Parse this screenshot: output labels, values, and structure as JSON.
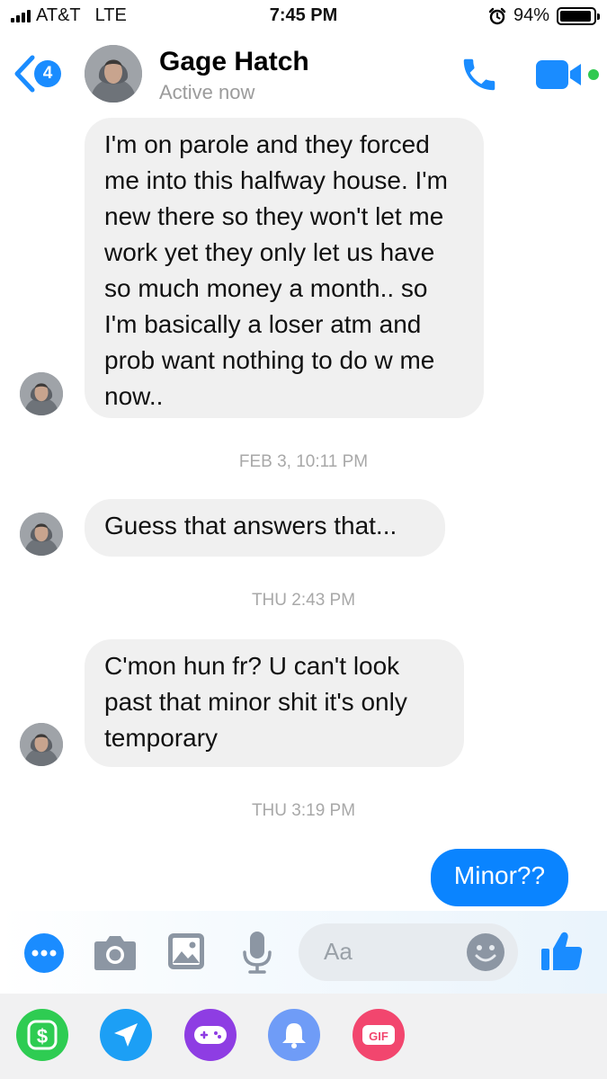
{
  "status_bar": {
    "carrier": "AT&T",
    "network": "LTE",
    "time": "7:45 PM",
    "battery_percent": "94%",
    "battery_level": 0.94
  },
  "header": {
    "back_badge_count": "4",
    "contact_name": "Gage Hatch",
    "contact_status": "Active now",
    "icons": [
      "back-chevron-icon",
      "phone-icon",
      "video-camera-icon",
      "online-dot-icon"
    ]
  },
  "messages": [
    {
      "from": "contact",
      "text": "I'm on parole and they forced me into this halfway house. I'm new there so they won't let me work yet they only let us have so much money a month.. so I'm basically a loser atm and prob want nothing to do w me now.."
    },
    {
      "type": "timestamp",
      "text": "FEB 3, 10:11 PM"
    },
    {
      "from": "contact",
      "text": "Guess that answers that..."
    },
    {
      "type": "timestamp",
      "text": "THU 2:43 PM"
    },
    {
      "from": "contact",
      "text": "C'mon hun fr? U can't look past that minor shit it's only temporary"
    },
    {
      "type": "timestamp",
      "text": "THU 3:19 PM"
    },
    {
      "from": "me",
      "text": "Minor??"
    }
  ],
  "composer": {
    "placeholder": "Aa",
    "icons": [
      "more-icon",
      "camera-icon",
      "gallery-icon",
      "microphone-icon",
      "emoji-icon",
      "thumbs-up-icon"
    ]
  },
  "tray": {
    "items": [
      {
        "icon": "payment-icon",
        "label": "$",
        "color": "#2ecc52"
      },
      {
        "icon": "location-icon",
        "label": "",
        "color": "#1c9ff5"
      },
      {
        "icon": "games-icon",
        "label": "",
        "color": "#8e3de3"
      },
      {
        "icon": "reminder-bell-icon",
        "label": "",
        "color": "#6f9cf7"
      },
      {
        "icon": "gif-icon",
        "label": "GIF",
        "color": "#f2466e"
      }
    ]
  },
  "colors": {
    "accent": "#0a84ff",
    "bubble_incoming": "#f0f0f0",
    "timestamp": "#a8a8a8"
  }
}
